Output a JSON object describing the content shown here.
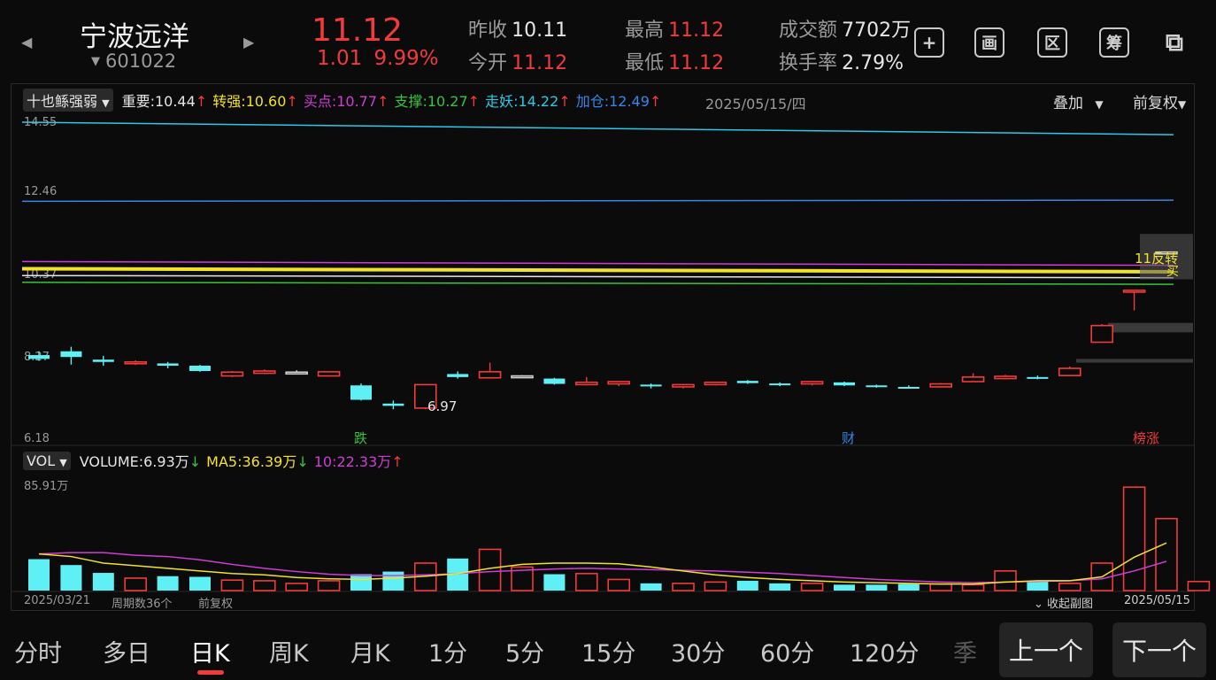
{
  "header": {
    "stock_name": "宁波远洋",
    "stock_code": "601022",
    "code_caret": "▼",
    "price": "11.12",
    "change": "1.01",
    "change_pct": "9.99%",
    "quotes": [
      {
        "label": "昨收",
        "value": "10.11",
        "color": "#e6e6e6"
      },
      {
        "label": "今开",
        "value": "11.12",
        "color": "#f23a3a"
      },
      {
        "label": "最高",
        "value": "11.12",
        "color": "#f23a3a"
      },
      {
        "label": "最低",
        "value": "11.12",
        "color": "#f23a3a"
      },
      {
        "label": "成交额",
        "value": "7702万",
        "color": "#e6e6e6"
      },
      {
        "label": "换手率",
        "value": "2.79%",
        "color": "#e6e6e6"
      }
    ],
    "tools": [
      {
        "icon": "plus-icon",
        "glyph": "+"
      },
      {
        "icon": "picture-icon",
        "glyph": "画"
      },
      {
        "icon": "region-icon",
        "glyph": "区"
      },
      {
        "icon": "chip-icon",
        "glyph": "筹"
      },
      {
        "icon": "device-switch-icon",
        "glyph": "⧉"
      }
    ]
  },
  "indicator": {
    "selector": "十也鲧强弱",
    "items": [
      {
        "label": "重要:",
        "value": "10.44",
        "arrow": "↑",
        "color": "#e6e6e6"
      },
      {
        "label": "转强:",
        "value": "10.60",
        "arrow": "↑",
        "color": "#f2e22a"
      },
      {
        "label": "买点:",
        "value": "10.77",
        "arrow": "↑",
        "color": "#d03cd6"
      },
      {
        "label": "支撑:",
        "value": "10.27",
        "arrow": "↑",
        "color": "#39c43b"
      },
      {
        "label": "走妖:",
        "value": "14.22",
        "arrow": "↑",
        "color": "#2ec8e6"
      },
      {
        "label": "加仓:",
        "value": "12.49",
        "arrow": "↑",
        "color": "#3a86e8"
      }
    ],
    "date": "2025/05/15/四",
    "overlay": "叠加",
    "adjust": "前复权"
  },
  "price_axis": {
    "ticks": [
      "14.55",
      "12.46",
      "10.37",
      "8.27",
      "6.18"
    ]
  },
  "annotations": {
    "low_label": "6.97",
    "right_tag": "11反转",
    "buy_tag": "买",
    "markers": [
      {
        "text": "跌",
        "color": "#39c43b"
      },
      {
        "text": "财",
        "color": "#3a86e8"
      },
      {
        "text": "榜涨",
        "color": "#f23a3a"
      }
    ]
  },
  "volume": {
    "selector": "VOL",
    "items": [
      {
        "label": "VOLUME:",
        "value": "6.93万",
        "arrow": "↓",
        "color": "#e6e6e6",
        "arrow_color": "#39c43b"
      },
      {
        "label": "MA5:",
        "value": "36.39万",
        "arrow": "↓",
        "color": "#f2e22a",
        "arrow_color": "#39c43b"
      },
      {
        "label": "10:",
        "value": "22.33万",
        "arrow": "↑",
        "color": "#d03cd6",
        "arrow_color": "#f23a3a"
      }
    ],
    "max_label": "85.91万"
  },
  "footer": {
    "start_date": "2025/03/21",
    "period_count": "周期数36个",
    "adjust": "前复权",
    "collapse": "⌄ 收起副图",
    "end_date": "2025/05/15"
  },
  "tabs": [
    "分时",
    "多日",
    "日K",
    "周K",
    "月K",
    "1分",
    "5分",
    "15分",
    "30分",
    "60分",
    "120分",
    "季"
  ],
  "active_tab": "日K",
  "pager": {
    "prev": "上一个",
    "next": "下一个"
  },
  "chart_data": {
    "type": "candlestick",
    "ylim": [
      6.18,
      14.55
    ],
    "candles": [
      {
        "o": 8.4,
        "h": 8.5,
        "l": 8.25,
        "c": 8.3
      },
      {
        "o": 8.5,
        "h": 8.62,
        "l": 8.15,
        "c": 8.35
      },
      {
        "o": 8.28,
        "h": 8.38,
        "l": 8.12,
        "c": 8.22
      },
      {
        "o": 8.18,
        "h": 8.26,
        "l": 8.14,
        "c": 8.22
      },
      {
        "o": 8.18,
        "h": 8.22,
        "l": 8.05,
        "c": 8.12
      },
      {
        "o": 8.12,
        "h": 8.14,
        "l": 7.96,
        "c": 7.98
      },
      {
        "o": 7.85,
        "h": 7.98,
        "l": 7.82,
        "c": 7.95
      },
      {
        "o": 7.92,
        "h": 8.02,
        "l": 7.9,
        "c": 7.98
      },
      {
        "o": 7.95,
        "h": 8.0,
        "l": 7.9,
        "c": 7.95
      },
      {
        "o": 7.85,
        "h": 7.98,
        "l": 7.84,
        "c": 7.96
      },
      {
        "o": 7.6,
        "h": 7.65,
        "l": 7.2,
        "c": 7.22
      },
      {
        "o": 7.12,
        "h": 7.2,
        "l": 6.97,
        "c": 7.06
      },
      {
        "o": 7.0,
        "h": 7.62,
        "l": 6.97,
        "c": 7.62
      },
      {
        "o": 7.9,
        "h": 7.97,
        "l": 7.78,
        "c": 7.82
      },
      {
        "o": 7.8,
        "h": 8.2,
        "l": 7.78,
        "c": 7.96
      },
      {
        "o": 7.85,
        "h": 7.87,
        "l": 7.8,
        "c": 7.85
      },
      {
        "o": 7.78,
        "h": 7.8,
        "l": 7.62,
        "c": 7.64
      },
      {
        "o": 7.62,
        "h": 7.82,
        "l": 7.6,
        "c": 7.68
      },
      {
        "o": 7.64,
        "h": 7.72,
        "l": 7.58,
        "c": 7.7
      },
      {
        "o": 7.62,
        "h": 7.65,
        "l": 7.52,
        "c": 7.58
      },
      {
        "o": 7.56,
        "h": 7.64,
        "l": 7.52,
        "c": 7.62
      },
      {
        "o": 7.62,
        "h": 7.7,
        "l": 7.6,
        "c": 7.68
      },
      {
        "o": 7.72,
        "h": 7.74,
        "l": 7.64,
        "c": 7.66
      },
      {
        "o": 7.65,
        "h": 7.68,
        "l": 7.58,
        "c": 7.62
      },
      {
        "o": 7.64,
        "h": 7.72,
        "l": 7.6,
        "c": 7.7
      },
      {
        "o": 7.68,
        "h": 7.7,
        "l": 7.58,
        "c": 7.6
      },
      {
        "o": 7.6,
        "h": 7.62,
        "l": 7.54,
        "c": 7.56
      },
      {
        "o": 7.56,
        "h": 7.6,
        "l": 7.52,
        "c": 7.54
      },
      {
        "o": 7.56,
        "h": 7.66,
        "l": 7.56,
        "c": 7.64
      },
      {
        "o": 7.7,
        "h": 7.92,
        "l": 7.7,
        "c": 7.82
      },
      {
        "o": 7.78,
        "h": 7.88,
        "l": 7.76,
        "c": 7.84
      },
      {
        "o": 7.82,
        "h": 7.86,
        "l": 7.76,
        "c": 7.78
      },
      {
        "o": 7.86,
        "h": 8.1,
        "l": 7.86,
        "c": 8.05
      },
      {
        "o": 8.74,
        "h": 9.22,
        "l": 8.74,
        "c": 9.18
      },
      {
        "o": 10.08,
        "h": 10.11,
        "l": 9.58,
        "c": 10.11
      },
      {
        "o": 11.12,
        "h": 11.12,
        "l": 11.12,
        "c": 11.12
      }
    ],
    "overlay_lines": [
      {
        "name": "走妖",
        "color": "#2ec8e6",
        "start": 14.55,
        "end": 14.22
      },
      {
        "name": "加仓",
        "color": "#3a86e8",
        "start": 12.46,
        "end": 12.49
      },
      {
        "name": "买点",
        "color": "#d03cd6",
        "start": 10.87,
        "end": 10.77
      },
      {
        "name": "转强",
        "color": "#f2e22a",
        "start": 10.68,
        "end": 10.6
      },
      {
        "name": "重要",
        "color": "#e6e6e6",
        "start": 10.5,
        "end": 10.44
      },
      {
        "name": "支撑",
        "color": "#39c43b",
        "start": 10.32,
        "end": 10.27
      }
    ],
    "volume_ylim": [
      0,
      85.91
    ],
    "volumes": [
      24.0,
      19.5,
      13.5,
      9.5,
      11.0,
      10.5,
      8.0,
      7.5,
      5.5,
      7.5,
      12.5,
      14.5,
      21.0,
      24.5,
      31.5,
      18.0,
      12.5,
      13.0,
      8.5,
      5.5,
      5.5,
      6.5,
      7.5,
      5.5,
      5.5,
      4.5,
      4.5,
      5.0,
      5.0,
      4.5,
      15.0,
      7.0,
      5.5,
      21.0,
      79.0,
      55.0,
      6.93
    ],
    "ma5": [
      28.0,
      26.0,
      21.0,
      19.0,
      17.0,
      15.0,
      13.0,
      12.0,
      10.0,
      9.0,
      8.5,
      9.5,
      11.0,
      13.0,
      17.0,
      20.0,
      21.0,
      21.0,
      20.5,
      18.0,
      15.0,
      12.0,
      10.0,
      8.5,
      7.5,
      6.5,
      6.0,
      5.5,
      5.0,
      5.0,
      6.5,
      7.5,
      7.5,
      10.5,
      25.5,
      36.39
    ],
    "ma10": [
      28.0,
      29.0,
      29.0,
      27.0,
      26.0,
      23.5,
      20.0,
      17.0,
      14.5,
      12.5,
      11.5,
      11.5,
      12.0,
      13.0,
      14.5,
      15.5,
      16.5,
      17.0,
      16.5,
      16.0,
      15.5,
      15.0,
      14.0,
      13.0,
      11.5,
      10.0,
      8.5,
      7.5,
      6.5,
      6.0,
      6.5,
      7.0,
      7.5,
      9.0,
      15.0,
      22.33
    ]
  }
}
